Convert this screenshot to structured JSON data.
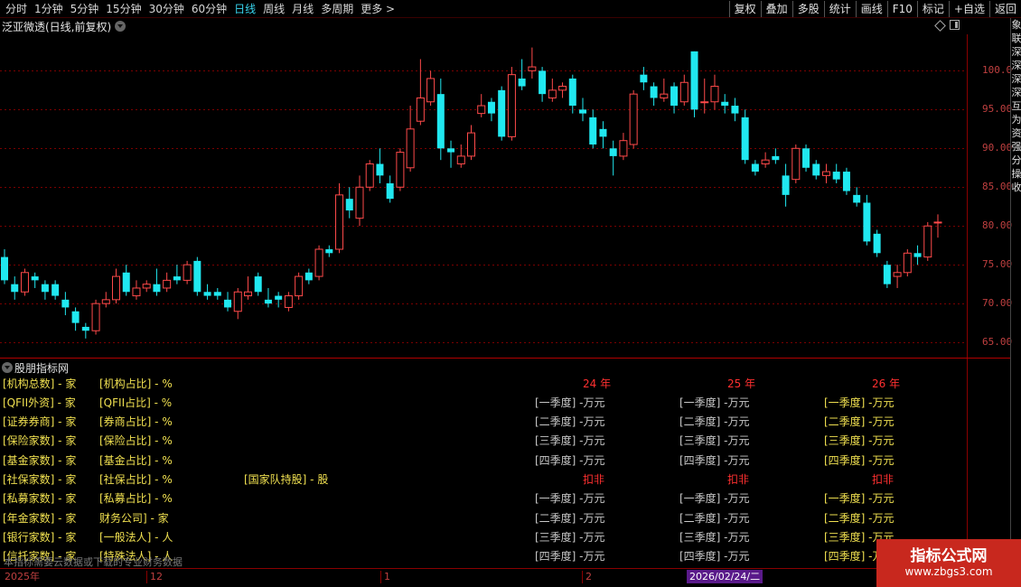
{
  "toolbar": {
    "periods": [
      {
        "label": "分时"
      },
      {
        "label": "1分钟"
      },
      {
        "label": "5分钟"
      },
      {
        "label": "15分钟"
      },
      {
        "label": "30分钟"
      },
      {
        "label": "60分钟"
      },
      {
        "label": "日线",
        "active": true
      },
      {
        "label": "周线"
      },
      {
        "label": "月线"
      },
      {
        "label": "多周期"
      },
      {
        "label": "更多 >"
      }
    ],
    "tools": [
      "复权",
      "叠加",
      "多股",
      "统计",
      "画线",
      "F10",
      "标记",
      "+自选",
      "返回"
    ]
  },
  "chart": {
    "title": "泛亚微透(日线,前复权)",
    "price_ticks": [
      "100.0",
      "95.00",
      "90.00",
      "85.00",
      "80.00",
      "75.00",
      "70.00",
      "65.00"
    ],
    "colors": {
      "up": "#ff4a4a",
      "down": "#20e8f0",
      "grid": "#7a0000",
      "axis": "#c04040"
    }
  },
  "chart_data": {
    "type": "candlestick",
    "ylim": [
      63.5,
      104.0
    ],
    "y_ticks": [
      65,
      70,
      75,
      80,
      85,
      90,
      95,
      100
    ],
    "candles": [
      [
        76.0,
        73.0,
        77.0,
        72.5
      ],
      [
        72.5,
        71.5,
        73.5,
        70.5
      ],
      [
        71.5,
        74.0,
        74.5,
        71.0
      ],
      [
        73.5,
        73.0,
        74.0,
        72.0
      ],
      [
        72.5,
        71.5,
        73.0,
        70.5
      ],
      [
        72.5,
        71.0,
        73.0,
        70.5
      ],
      [
        70.5,
        69.5,
        71.5,
        68.5
      ],
      [
        69.0,
        67.5,
        69.5,
        66.5
      ],
      [
        67.0,
        66.5,
        67.5,
        65.5
      ],
      [
        66.5,
        70.0,
        70.5,
        66.0
      ],
      [
        70.0,
        70.5,
        71.5,
        69.5
      ],
      [
        70.5,
        73.5,
        74.5,
        70.0
      ],
      [
        74.0,
        71.5,
        75.0,
        71.0
      ],
      [
        71.0,
        72.0,
        73.0,
        70.5
      ],
      [
        72.0,
        72.5,
        73.0,
        71.5
      ],
      [
        72.5,
        71.5,
        74.5,
        71.0
      ],
      [
        72.0,
        73.0,
        74.0,
        71.5
      ],
      [
        73.5,
        73.0,
        75.0,
        72.5
      ],
      [
        73.0,
        75.0,
        75.5,
        72.5
      ],
      [
        75.5,
        71.5,
        76.0,
        71.0
      ],
      [
        71.5,
        71.0,
        72.5,
        70.5
      ],
      [
        71.5,
        71.0,
        72.0,
        70.5
      ],
      [
        70.5,
        69.5,
        71.5,
        69.0
      ],
      [
        69.0,
        71.5,
        72.0,
        68.0
      ],
      [
        71.0,
        71.5,
        73.5,
        70.5
      ],
      [
        73.5,
        71.5,
        74.0,
        71.0
      ],
      [
        70.5,
        70.0,
        72.0,
        69.5
      ],
      [
        71.0,
        70.5,
        71.5,
        69.5
      ],
      [
        69.5,
        71.0,
        71.5,
        69.0
      ],
      [
        71.0,
        73.5,
        74.0,
        70.5
      ],
      [
        74.0,
        73.0,
        74.5,
        72.5
      ],
      [
        73.5,
        77.0,
        77.5,
        73.0
      ],
      [
        77.0,
        76.5,
        77.5,
        76.0
      ],
      [
        77.0,
        84.0,
        85.5,
        76.5
      ],
      [
        83.5,
        82.0,
        85.0,
        81.0
      ],
      [
        81.0,
        85.0,
        86.5,
        80.0
      ],
      [
        85.0,
        88.0,
        88.5,
        84.5
      ],
      [
        88.0,
        86.5,
        90.0,
        85.5
      ],
      [
        85.5,
        83.5,
        86.5,
        83.0
      ],
      [
        85.0,
        89.5,
        90.0,
        84.5
      ],
      [
        87.5,
        92.5,
        95.5,
        87.0
      ],
      [
        93.5,
        96.5,
        101.5,
        93.0
      ],
      [
        96.0,
        99.0,
        100.0,
        95.5
      ],
      [
        97.0,
        90.0,
        99.0,
        88.5
      ],
      [
        90.0,
        89.5,
        91.0,
        87.5
      ],
      [
        88.0,
        89.0,
        90.5,
        87.5
      ],
      [
        89.0,
        92.0,
        93.0,
        88.5
      ],
      [
        94.5,
        95.5,
        97.0,
        94.0
      ],
      [
        96.0,
        94.5,
        96.5,
        93.5
      ],
      [
        97.5,
        91.5,
        98.0,
        91.0
      ],
      [
        91.5,
        99.5,
        100.5,
        91.0
      ],
      [
        99.0,
        98.0,
        101.5,
        97.5
      ],
      [
        100.0,
        100.5,
        103.0,
        99.0
      ],
      [
        100.0,
        97.0,
        100.5,
        96.0
      ],
      [
        96.5,
        97.5,
        99.0,
        96.0
      ],
      [
        97.5,
        98.0,
        98.5,
        96.5
      ],
      [
        99.0,
        95.5,
        99.5,
        94.5
      ],
      [
        95.0,
        94.5,
        96.5,
        93.5
      ],
      [
        94.0,
        90.5,
        95.0,
        90.0
      ],
      [
        92.5,
        91.5,
        93.5,
        90.0
      ],
      [
        90.0,
        89.0,
        91.0,
        86.5
      ],
      [
        89.0,
        91.0,
        92.0,
        88.5
      ],
      [
        90.5,
        97.0,
        97.5,
        90.0
      ],
      [
        99.5,
        98.5,
        100.5,
        97.5
      ],
      [
        98.0,
        96.5,
        98.5,
        95.5
      ],
      [
        96.5,
        97.0,
        99.0,
        96.0
      ],
      [
        98.0,
        95.5,
        98.5,
        94.5
      ],
      [
        96.0,
        98.5,
        99.5,
        95.5
      ],
      [
        102.5,
        95.0,
        102.5,
        94.0
      ],
      [
        96.0,
        96.0,
        99.0,
        94.5
      ],
      [
        96.0,
        98.0,
        99.5,
        95.0
      ],
      [
        96.0,
        95.5,
        97.0,
        94.5
      ],
      [
        95.5,
        94.5,
        96.5,
        93.5
      ],
      [
        94.0,
        88.5,
        95.0,
        88.0
      ],
      [
        88.0,
        87.0,
        88.5,
        86.5
      ],
      [
        88.0,
        88.5,
        89.5,
        87.5
      ],
      [
        89.0,
        88.5,
        90.0,
        88.0
      ],
      [
        86.5,
        84.0,
        88.0,
        82.5
      ],
      [
        86.0,
        90.0,
        90.5,
        85.5
      ],
      [
        90.0,
        87.5,
        90.5,
        87.0
      ],
      [
        88.0,
        86.5,
        88.5,
        86.0
      ],
      [
        86.5,
        87.0,
        88.0,
        85.5
      ],
      [
        87.0,
        86.0,
        88.0,
        85.5
      ],
      [
        87.0,
        84.5,
        87.5,
        84.0
      ],
      [
        84.0,
        83.0,
        85.0,
        82.5
      ],
      [
        83.0,
        78.0,
        84.0,
        77.5
      ],
      [
        79.0,
        76.5,
        79.5,
        76.0
      ],
      [
        75.0,
        72.5,
        75.5,
        72.0
      ],
      [
        73.5,
        74.0,
        75.0,
        72.0
      ],
      [
        74.0,
        76.5,
        77.0,
        73.5
      ],
      [
        76.5,
        76.0,
        77.5,
        75.0
      ],
      [
        76.0,
        80.0,
        80.5,
        75.5
      ],
      [
        80.5,
        80.5,
        81.5,
        78.5
      ]
    ]
  },
  "indicator": {
    "title": "股朋指标网",
    "left_rows": [
      [
        "[机构总数] - 家",
        "[机构占比] - %"
      ],
      [
        "[QFII外资] - 家",
        "[QFII占比] - %"
      ],
      [
        "[证券券商] - 家",
        "[券商占比] - %"
      ],
      [
        "[保险家数] - 家",
        "[保险占比] - %"
      ],
      [
        "[基金家数] - 家",
        "[基金占比] - %"
      ],
      [
        "[社保家数] - 家",
        "[社保占比] - %"
      ],
      [
        "[私募家数] - 家",
        "[私募占比] - %"
      ],
      [
        "[年金家数] - 家",
        "财务公司] - 家"
      ],
      [
        "[银行家数] - 家",
        "[一般法人] - 人"
      ],
      [
        "[信托家数] - 家",
        "[特殊法人] - 人"
      ]
    ],
    "national_team": "[国家队持股] - 股",
    "years": [
      "24 年",
      "25 年",
      "26 年"
    ],
    "deduct_label": "扣非",
    "quarters_1": [
      "[一季度] -万元",
      "[二季度] -万元",
      "[三季度] -万元",
      "[四季度] -万元"
    ],
    "quarters_2": [
      "[一季度] -万元",
      "[二季度] -万元",
      "[三季度] -万元",
      "[四季度] -万元"
    ],
    "footnote": "本指标需要云数据或下载的专业财务数据"
  },
  "date_axis": {
    "labels": [
      "2025年",
      "12",
      "1",
      "2"
    ],
    "cursor": "2026/02/24/二"
  },
  "right_strip": [
    "象",
    "联",
    "深",
    "深",
    "深",
    "深",
    "互",
    "为",
    "资",
    "强",
    "分",
    "操",
    "收"
  ],
  "watermark": {
    "title": "指标公式网",
    "url": "www.zbgs3.com"
  }
}
